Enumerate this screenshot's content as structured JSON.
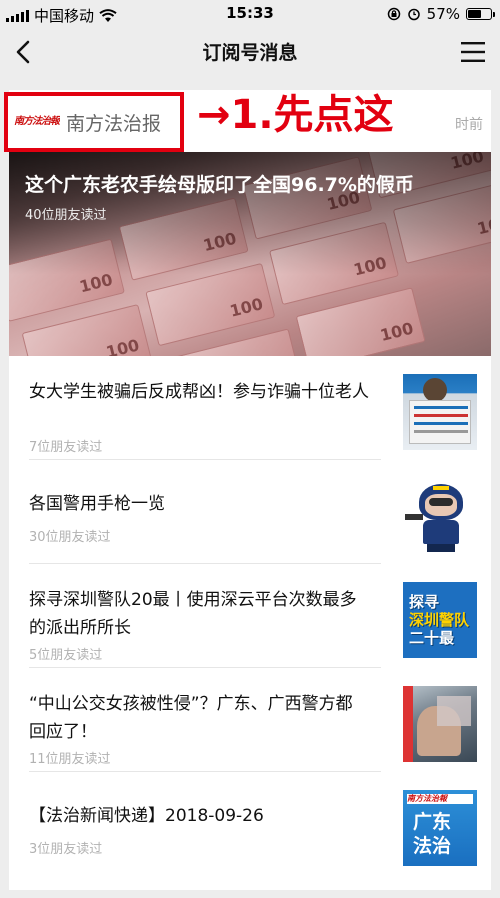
{
  "status_bar": {
    "carrier": "中国移动",
    "time": "15:33",
    "battery_percent": "57%",
    "battery_level": 0.57
  },
  "nav": {
    "title": "订阅号消息"
  },
  "account": {
    "logo_text": "南方法治報",
    "name": "南方法治报",
    "annotation": "→1.先点这",
    "push_time_partial": "时前"
  },
  "hero": {
    "title": "这个广东老农手绘母版印了全国96.7%的假币",
    "reads": "40位朋友读过",
    "note_label": "100"
  },
  "articles": [
    {
      "title": "女大学生被骗后反成帮凶！参与诈骗十位老人",
      "reads": "7位朋友读过",
      "thumb": "news-photo"
    },
    {
      "title": "各国警用手枪一览",
      "reads": "30位朋友读过",
      "thumb": "police-cartoon"
    },
    {
      "title": "探寻深圳警队20最丨使用深云平台次数最多的派出所所长",
      "reads": "5位朋友读过",
      "thumb": "police-poster",
      "thumb_lines": [
        "探寻",
        "深圳警队",
        "二十最"
      ]
    },
    {
      "title": "“中山公交女孩被性侵”？广东、广西警方都回应了！",
      "reads": "11位朋友读过",
      "thumb": "incident-photo"
    },
    {
      "title": "【法治新闻快递】2018-09-26",
      "reads": "3位朋友读过",
      "thumb": "brand-card",
      "thumb_mast": "南方法治報",
      "thumb_lines": [
        "广东",
        "法治"
      ]
    }
  ]
}
